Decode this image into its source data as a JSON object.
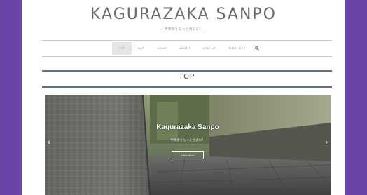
{
  "site": {
    "title": "KAGURAZAKA SANPO",
    "tagline": "— 神楽坂をもっと身近に！ —"
  },
  "nav": {
    "items": [
      {
        "label": "TOP",
        "active": true
      },
      {
        "label": "MAP"
      },
      {
        "label": "NEWS"
      },
      {
        "label": "ABOUT"
      },
      {
        "label": "LINE UP"
      },
      {
        "label": "SHOP LIST"
      }
    ],
    "search_icon": "search-icon"
  },
  "section": {
    "heading": "TOP"
  },
  "slider": {
    "title": "Kagurazaka Sanpo",
    "subtitle": "神楽坂をもっと身近に！",
    "button_label": "Click Here",
    "prev_icon": "‹",
    "next_icon": "›"
  },
  "colors": {
    "background": "#6a45a6",
    "heading_bar": "#5e6f86",
    "nav_active_bg": "#e6e6e6"
  }
}
